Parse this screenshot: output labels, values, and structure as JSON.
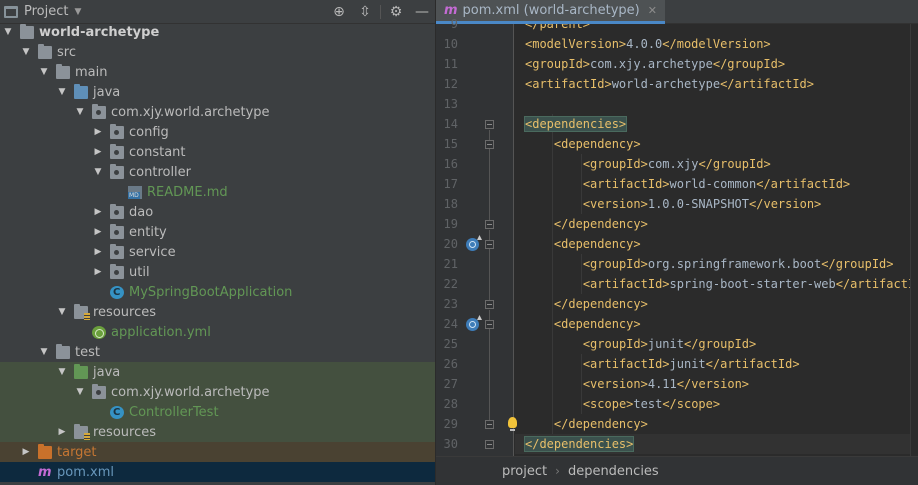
{
  "panel": {
    "title": "Project",
    "tools": [
      "locate-icon",
      "collapse-icon",
      "gear-icon",
      "hide-icon"
    ]
  },
  "tree": [
    {
      "label": "world-archetype",
      "depth": 1,
      "arrow": "down",
      "icon": "folder",
      "style": "bold"
    },
    {
      "label": "src",
      "depth": 2,
      "arrow": "down",
      "icon": "folder"
    },
    {
      "label": "main",
      "depth": 3,
      "arrow": "down",
      "icon": "folder"
    },
    {
      "label": "java",
      "depth": 4,
      "arrow": "down",
      "icon": "folder-blue"
    },
    {
      "label": "com.xjy.world.archetype",
      "depth": 5,
      "arrow": "down",
      "icon": "package"
    },
    {
      "label": "config",
      "depth": 6,
      "arrow": "right",
      "icon": "package"
    },
    {
      "label": "constant",
      "depth": 6,
      "arrow": "right",
      "icon": "package"
    },
    {
      "label": "controller",
      "depth": 6,
      "arrow": "down",
      "icon": "package"
    },
    {
      "label": "README.md",
      "depth": 7,
      "arrow": "none",
      "icon": "markdown",
      "style": "green"
    },
    {
      "label": "dao",
      "depth": 6,
      "arrow": "right",
      "icon": "package"
    },
    {
      "label": "entity",
      "depth": 6,
      "arrow": "right",
      "icon": "package"
    },
    {
      "label": "service",
      "depth": 6,
      "arrow": "right",
      "icon": "package"
    },
    {
      "label": "util",
      "depth": 6,
      "arrow": "right",
      "icon": "package"
    },
    {
      "label": "MySpringBootApplication",
      "depth": 6,
      "arrow": "none",
      "icon": "spring-class",
      "style": "green"
    },
    {
      "label": "resources",
      "depth": 4,
      "arrow": "down",
      "icon": "resources"
    },
    {
      "label": "application.yml",
      "depth": 5,
      "arrow": "none",
      "icon": "spring-config",
      "style": "green"
    },
    {
      "label": "test",
      "depth": 3,
      "arrow": "down",
      "icon": "folder"
    },
    {
      "label": "java",
      "depth": 4,
      "arrow": "down",
      "icon": "folder-green",
      "bg": "test"
    },
    {
      "label": "com.xjy.world.archetype",
      "depth": 5,
      "arrow": "down",
      "icon": "package",
      "bg": "test"
    },
    {
      "label": "ControllerTest",
      "depth": 6,
      "arrow": "none",
      "icon": "class",
      "style": "green",
      "bg": "test"
    },
    {
      "label": "resources",
      "depth": 4,
      "arrow": "right",
      "icon": "resources",
      "bg": "test"
    },
    {
      "label": "target",
      "depth": 2,
      "arrow": "right",
      "icon": "folder-orange",
      "style": "orange",
      "bg": "target"
    },
    {
      "label": "pom.xml",
      "depth": 2,
      "arrow": "none",
      "icon": "maven",
      "style": "blue",
      "bg": "selected"
    }
  ],
  "editor": {
    "tab_label": "pom.xml (world-archetype)",
    "lines": [
      {
        "num": "9",
        "indent": 1,
        "code": "</parent>"
      },
      {
        "num": "10",
        "indent": 1,
        "code": "<modelVersion>4.0.0</modelVersion>"
      },
      {
        "num": "11",
        "indent": 1,
        "code": "<groupId>com.xjy.archetype</groupId>"
      },
      {
        "num": "12",
        "indent": 1,
        "code": "<artifactId>world-archetype</artifactId>"
      },
      {
        "num": "13",
        "indent": 0,
        "code": ""
      },
      {
        "num": "14",
        "indent": 1,
        "code": "<dependencies>"
      },
      {
        "num": "15",
        "indent": 2,
        "code": "<dependency>"
      },
      {
        "num": "16",
        "indent": 3,
        "code": "<groupId>com.xjy</groupId>"
      },
      {
        "num": "17",
        "indent": 3,
        "code": "<artifactId>world-common</artifactId>"
      },
      {
        "num": "18",
        "indent": 3,
        "code": "<version>1.0.0-SNAPSHOT</version>"
      },
      {
        "num": "19",
        "indent": 2,
        "code": "</dependency>"
      },
      {
        "num": "20",
        "indent": 2,
        "code": "<dependency>"
      },
      {
        "num": "21",
        "indent": 3,
        "code": "<groupId>org.springframework.boot</groupId>"
      },
      {
        "num": "22",
        "indent": 3,
        "code": "<artifactId>spring-boot-starter-web</artifactId>"
      },
      {
        "num": "23",
        "indent": 2,
        "code": "</dependency>"
      },
      {
        "num": "24",
        "indent": 2,
        "code": "<dependency>"
      },
      {
        "num": "25",
        "indent": 3,
        "code": "<groupId>junit</groupId>"
      },
      {
        "num": "26",
        "indent": 3,
        "code": "<artifactId>junit</artifactId>"
      },
      {
        "num": "27",
        "indent": 3,
        "code": "<version>4.11</version>"
      },
      {
        "num": "28",
        "indent": 3,
        "code": "<scope>test</scope>"
      },
      {
        "num": "29",
        "indent": 2,
        "code": "</dependency>"
      },
      {
        "num": "30",
        "indent": 1,
        "code": "</dependencies>"
      }
    ],
    "current_line": "30",
    "matched_tag_lines": [
      "14",
      "30"
    ],
    "gutter_icons": [
      "20",
      "24"
    ],
    "bulb_line": "29",
    "fold_lines": [
      "14",
      "15",
      "19",
      "20",
      "23",
      "24",
      "29",
      "30"
    ]
  },
  "breadcrumb": [
    "project",
    "dependencies"
  ],
  "colors": {
    "tag": "#e8bf6a",
    "text": "#a9b7c6",
    "accent": "#4a88c7",
    "tree_green": "#629755",
    "tree_orange": "#c57633"
  }
}
